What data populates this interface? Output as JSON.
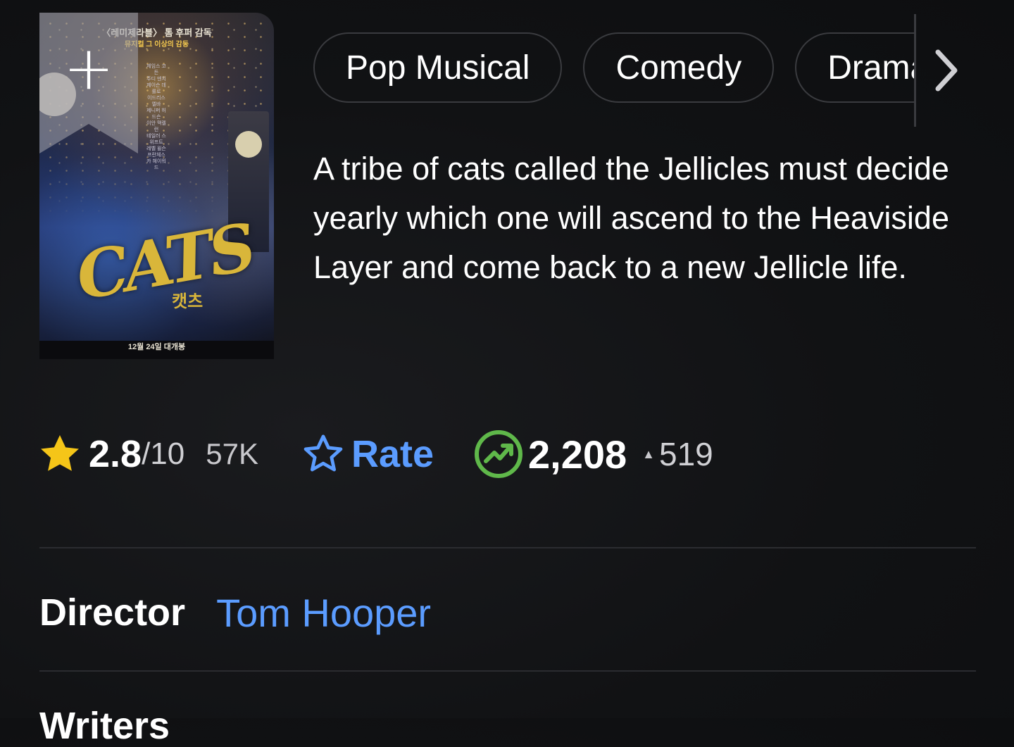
{
  "poster": {
    "header_line1": "〈레미제라블〉 톰 후퍼 감독",
    "header_line2": "뮤지컬 그 이상의 감동",
    "cast": [
      "제임스 코든",
      "주디 덴치",
      "제이슨 데룰로",
      "이드리스 엘바",
      "제니퍼 허드슨",
      "이안 맥켈런",
      "테일러 스위프트",
      "레벨 윌슨",
      "프란체스카 헤이워드"
    ],
    "title_art": "CATS",
    "title_korean": "캣츠",
    "release_text": "12월 24일 대개봉",
    "add_icon": "plus-icon"
  },
  "genres": [
    "Pop Musical",
    "Comedy",
    "Drama"
  ],
  "plot": "A tribe of cats called the Jellicles must decide yearly which one will ascend to the Heaviside Layer and come back to a new Jellicle life.",
  "rating": {
    "value": "2.8",
    "max": "/10",
    "count": "57K",
    "star_color": "#f5c518"
  },
  "rate_button": {
    "label": "Rate",
    "color": "#5b9cff"
  },
  "popularity": {
    "value": "2,208",
    "arrow": "▲",
    "change": "519",
    "icon_color": "#5fb84a"
  },
  "credits": {
    "director_label": "Director",
    "director_name": "Tom Hooper",
    "next_label": "Writers"
  }
}
